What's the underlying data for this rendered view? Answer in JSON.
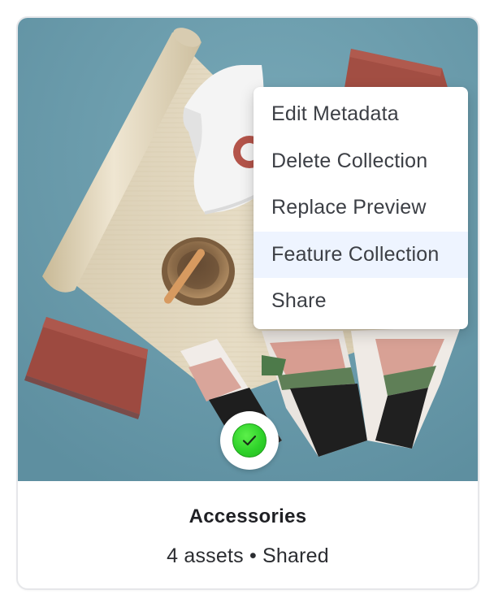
{
  "colors": {
    "background": "#6b9eae",
    "menu_highlight": "#eef4ff",
    "status_green": "#2fd22a"
  },
  "preview": {
    "icons": [
      "yoga-mat-icon",
      "yoga-block-icon",
      "sports-bra-icon",
      "singing-bowl-icon",
      "leggings-icon"
    ]
  },
  "menu": {
    "items": [
      {
        "label": "Edit Metadata"
      },
      {
        "label": "Delete Collection"
      },
      {
        "label": "Replace Preview"
      },
      {
        "label": "Feature Collection"
      },
      {
        "label": "Share"
      }
    ],
    "highlighted_index": 3
  },
  "status": {
    "icon": "checkmark-icon",
    "state": "selected"
  },
  "collection": {
    "title": "Accessories",
    "meta": "4 assets • Shared"
  }
}
